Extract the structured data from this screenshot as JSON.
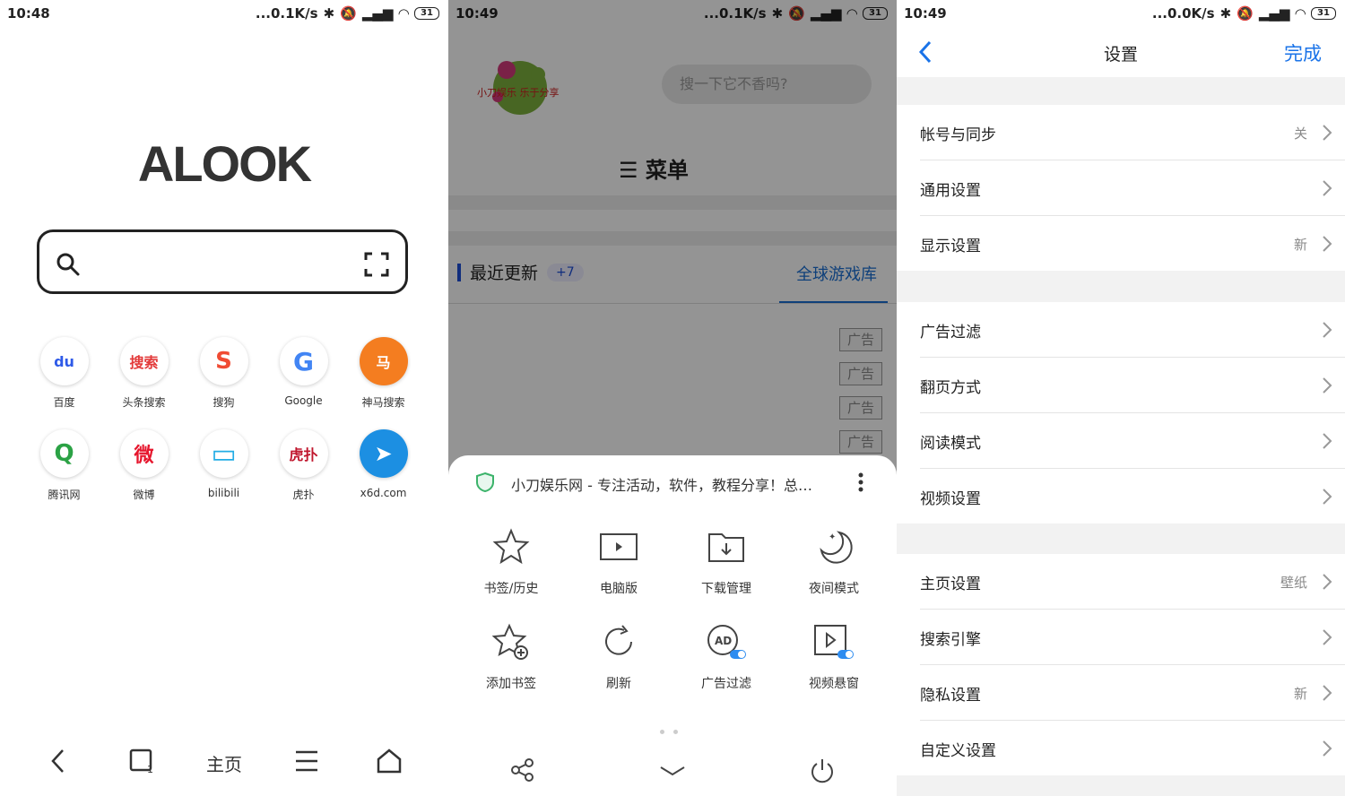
{
  "panel1": {
    "status": {
      "time": "10:48",
      "speed": "...0.1K/s",
      "battery": "31"
    },
    "logo": "ALOOK",
    "shortcuts": [
      {
        "label": "百度",
        "icon": "baidu-icon",
        "glyph": "du",
        "color": "#2e5ae8"
      },
      {
        "label": "头条搜索",
        "icon": "toutiao-search-icon",
        "glyph": "搜索",
        "color": "#e33a3a"
      },
      {
        "label": "搜狗",
        "icon": "sogou-icon",
        "glyph": "S",
        "color": "#f04b33"
      },
      {
        "label": "Google",
        "icon": "google-icon",
        "glyph": "G",
        "color": "#4285f4"
      },
      {
        "label": "神马搜索",
        "icon": "shenma-icon",
        "glyph": "马",
        "color": "#f47d20"
      },
      {
        "label": "腾讯网",
        "icon": "tencent-icon",
        "glyph": "Q",
        "color": "#2ba245"
      },
      {
        "label": "微博",
        "icon": "weibo-icon",
        "glyph": "微",
        "color": "#e6162d"
      },
      {
        "label": "bilibili",
        "icon": "bilibili-icon",
        "glyph": "▭",
        "color": "#23ade5"
      },
      {
        "label": "虎扑",
        "icon": "hupu-icon",
        "glyph": "虎扑",
        "color": "#c0172e"
      },
      {
        "label": "x6d.com",
        "icon": "x6d-compass-icon",
        "glyph": "➤",
        "color": "#1c8fe2"
      }
    ],
    "bottom": {
      "home_label": "主页"
    }
  },
  "panel2": {
    "status": {
      "time": "10:49",
      "speed": "...0.1K/s",
      "battery": "31"
    },
    "site_search_placeholder": "搜一下它不香吗?",
    "site_logo_text": "小刀娱乐 乐于分享",
    "site_menu": "菜单",
    "recent_label": "最近更新",
    "recent_badge": "+7",
    "game_lib": "全球游戏库",
    "ads": [
      "广告",
      "广告",
      "广告",
      "广告"
    ],
    "sheet_title": "小刀娱乐网 - 专注活动，软件，教程分享！总之...",
    "menu": [
      {
        "label": "书签/历史",
        "icon": "bookmark-star-icon"
      },
      {
        "label": "电脑版",
        "icon": "desktop-mode-icon"
      },
      {
        "label": "下载管理",
        "icon": "download-folder-icon"
      },
      {
        "label": "夜间模式",
        "icon": "night-mode-icon"
      },
      {
        "label": "添加书签",
        "icon": "add-bookmark-icon"
      },
      {
        "label": "刷新",
        "icon": "refresh-icon"
      },
      {
        "label": "广告过滤",
        "icon": "ad-filter-icon"
      },
      {
        "label": "视频悬窗",
        "icon": "video-float-icon"
      }
    ]
  },
  "panel3": {
    "status": {
      "time": "10:49",
      "speed": "...0.0K/s",
      "battery": "31"
    },
    "title": "设置",
    "done": "完成",
    "groups": [
      [
        {
          "label": "帐号与同步",
          "value": "关"
        },
        {
          "label": "通用设置",
          "value": ""
        },
        {
          "label": "显示设置",
          "value": "新"
        }
      ],
      [
        {
          "label": "广告过滤",
          "value": ""
        },
        {
          "label": "翻页方式",
          "value": ""
        },
        {
          "label": "阅读模式",
          "value": ""
        },
        {
          "label": "视频设置",
          "value": ""
        }
      ],
      [
        {
          "label": "主页设置",
          "value": "壁纸"
        },
        {
          "label": "搜索引擎",
          "value": ""
        },
        {
          "label": "隐私设置",
          "value": "新"
        },
        {
          "label": "自定义设置",
          "value": ""
        }
      ]
    ]
  }
}
